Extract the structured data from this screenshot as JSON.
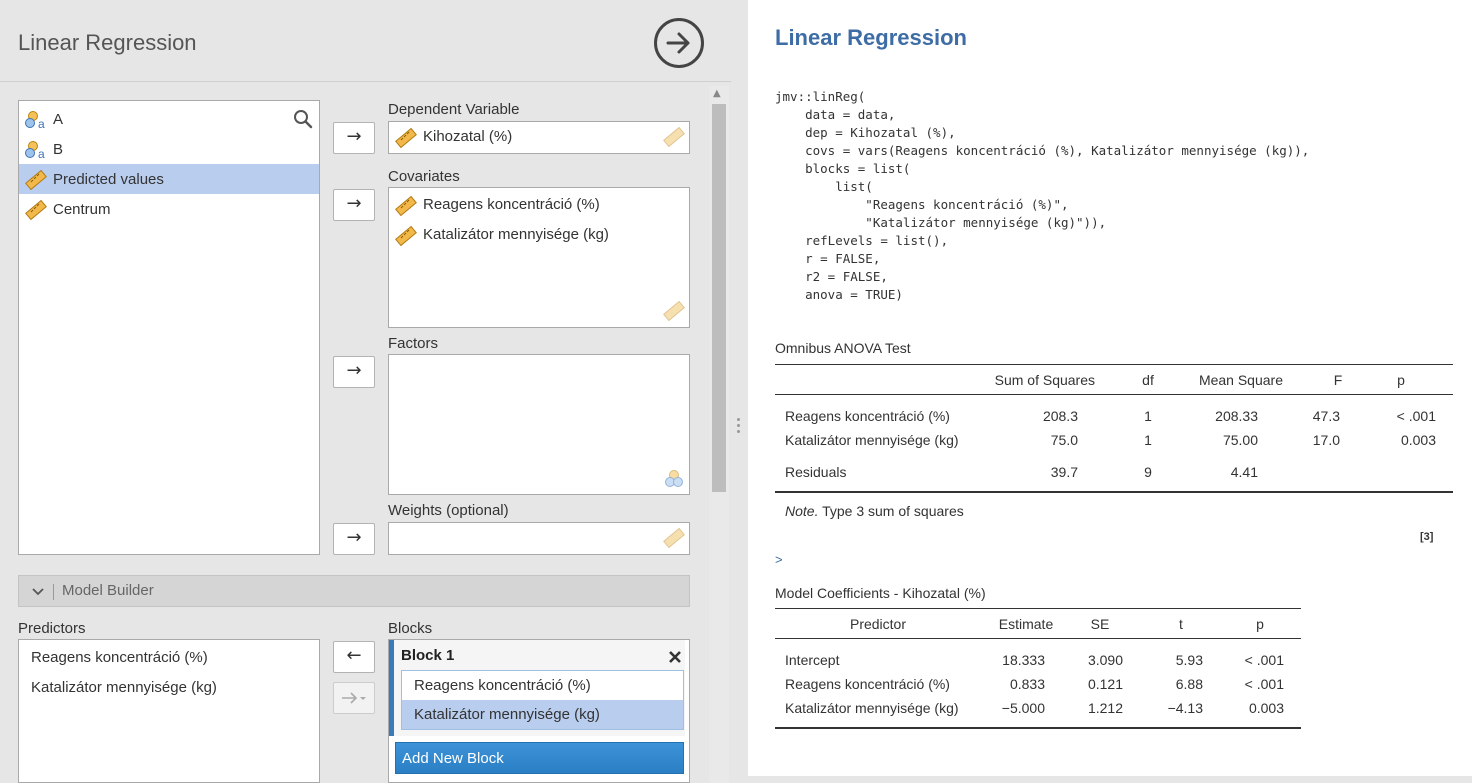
{
  "options": {
    "title": "Linear Regression",
    "variables": [
      {
        "label": "A",
        "type": "nominal"
      },
      {
        "label": "B",
        "type": "nominal"
      },
      {
        "label": "Predicted values",
        "type": "continuous",
        "selected": true
      },
      {
        "label": "Centrum",
        "type": "continuous"
      }
    ],
    "move_arrow": "→",
    "move_back_arrow": "←",
    "dependent_label": "Dependent Variable",
    "dependent_value": "Kihozatal (%)",
    "covariates_label": "Covariates",
    "covariates": [
      "Reagens koncentráció (%)",
      "Katalizátor mennyisége (kg)"
    ],
    "factors_label": "Factors",
    "weights_label": "Weights (optional)",
    "model_builder_label": "Model Builder",
    "predictors_label": "Predictors",
    "predictors": [
      "Reagens koncentráció (%)",
      "Katalizátor mennyisége (kg)"
    ],
    "blocks_label": "Blocks",
    "block1_title": "Block 1",
    "block1_items": [
      "Reagens koncentráció (%)",
      "Katalizátor mennyisége (kg)"
    ],
    "add_block_label": "Add New Block"
  },
  "results": {
    "title": "Linear Regression",
    "code": "jmv::linReg(\n    data = data,\n    dep = Kihozatal (%),\n    covs = vars(Reagens koncentráció (%), Katalizátor mennyisége (kg)),\n    blocks = list(\n        list(\n            \"Reagens koncentráció (%)\",\n            \"Katalizátor mennyisége (kg)\")),\n    refLevels = list(),\n    r = FALSE,\n    r2 = FALSE,\n    anova = TRUE)",
    "anova": {
      "title": "Omnibus ANOVA Test",
      "headers": [
        "Sum of Squares",
        "df",
        "Mean Square",
        "F",
        "p"
      ],
      "rows": [
        {
          "name": "Reagens koncentráció (%)",
          "ss": "208.3",
          "df": "1",
          "ms": "208.33",
          "f": "47.3",
          "p": "< .001"
        },
        {
          "name": "Katalizátor mennyisége (kg)",
          "ss": "75.0",
          "df": "1",
          "ms": "75.00",
          "f": "17.0",
          "p": "0.003"
        },
        {
          "name": "Residuals",
          "ss": "39.7",
          "df": "9",
          "ms": "4.41",
          "f": "",
          "p": ""
        }
      ],
      "note_label": "Note.",
      "note_text": " Type 3 sum of squares"
    },
    "ref": "[3]",
    "prompt": ">",
    "coefficients": {
      "title": "Model Coefficients - Kihozatal (%)",
      "headers": [
        "Predictor",
        "Estimate",
        "SE",
        "t",
        "p"
      ],
      "rows": [
        {
          "name": "Intercept",
          "est": "18.333",
          "se": "3.090",
          "t": "5.93",
          "p": "< .001"
        },
        {
          "name": "Reagens koncentráció (%)",
          "est": "0.833",
          "se": "0.121",
          "t": "6.88",
          "p": "< .001"
        },
        {
          "name": "Katalizátor mennyisége (kg)",
          "est": "−5.000",
          "se": "1.212",
          "t": "−4.13",
          "p": "0.003"
        }
      ]
    }
  },
  "colors": {
    "accent": "#3e6da6",
    "selection": "#b9cdee",
    "button": "#2b7fc4"
  }
}
